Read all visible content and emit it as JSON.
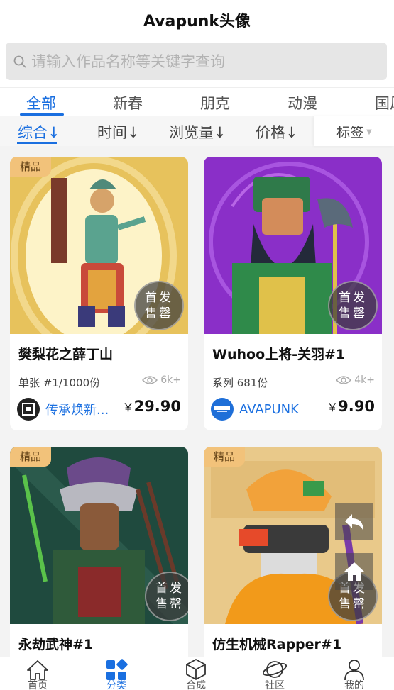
{
  "header": {
    "title": "Avapunk头像"
  },
  "search": {
    "placeholder": "请输入作品名称等关键字查询"
  },
  "category_tabs": [
    "全部",
    "新春",
    "朋克",
    "动漫",
    "国风"
  ],
  "active_category": "全部",
  "sort_options": [
    "综合↓",
    "时间↓",
    "浏览量↓",
    "价格↓"
  ],
  "active_sort": "综合↓",
  "tag_filter": {
    "label": "标签"
  },
  "cards": [
    {
      "badge": "精品",
      "sold_label": [
        "首发",
        "售罄"
      ],
      "name": "樊梨花之薛丁山",
      "meta": "单张 #1/1000份",
      "views": "6k+",
      "creator": "传承焕新...",
      "currency": "￥",
      "price": "29.90",
      "art_colors": [
        "#e7c25c",
        "#fdf3c8"
      ],
      "avatar_color": "#222222"
    },
    {
      "badge": "",
      "sold_label": [
        "首发",
        "售罄"
      ],
      "name": "Wuhoo上将-关羽#1",
      "meta": "系列 681份",
      "views": "4k+",
      "creator": "AVAPUNK",
      "currency": "￥",
      "price": "9.90",
      "art_colors": [
        "#8a2fc8",
        "#b865e6"
      ],
      "avatar_color": "#1f6fd8"
    },
    {
      "badge": "精品",
      "sold_label": [
        "首发",
        "售罄"
      ],
      "name": "永劫武神#1",
      "meta": "",
      "views": "",
      "creator": "",
      "currency": "",
      "price": "",
      "art_colors": [
        "#1f4a3e",
        "#3a6b56"
      ],
      "avatar_color": ""
    },
    {
      "badge": "精品",
      "sold_label": [
        "首发",
        "售罄"
      ],
      "name": "仿生机械Rapper#1",
      "meta": "",
      "views": "",
      "creator": "",
      "currency": "",
      "price": "",
      "art_colors": [
        "#e9c98a",
        "#f2a23a"
      ],
      "avatar_color": ""
    }
  ],
  "bottom_nav": [
    {
      "label": "首页",
      "icon": "home-icon"
    },
    {
      "label": "分类",
      "icon": "category-icon"
    },
    {
      "label": "合成",
      "icon": "cube-icon"
    },
    {
      "label": "社区",
      "icon": "planet-icon"
    },
    {
      "label": "我的",
      "icon": "user-icon"
    }
  ],
  "active_nav": "分类",
  "colors": {
    "accent": "#1a6fe0",
    "badge": "#f2c27a"
  }
}
